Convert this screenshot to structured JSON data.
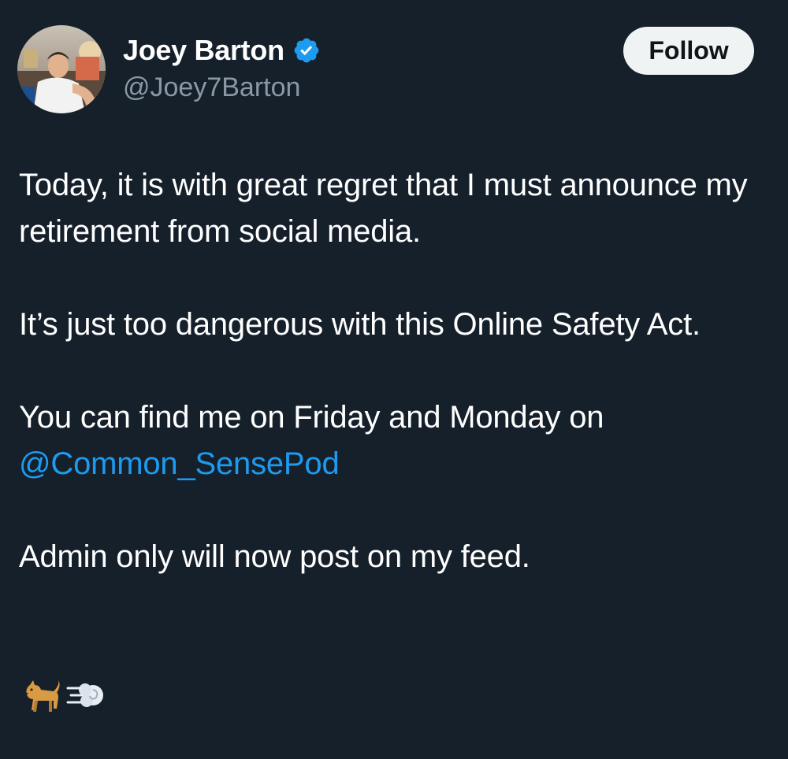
{
  "author": {
    "display_name": "Joey Barton",
    "handle": "@Joey7Barton",
    "verified": true,
    "avatar_icon": "profile-photo"
  },
  "follow_button": {
    "label": "Follow"
  },
  "tweet": {
    "line1": "Today, it is with great regret that I must announce my retirement from social media.",
    "line2": "It’s just too dangerous with this Online Safety Act.",
    "line3_prefix": "You can find me on Friday and Monday on",
    "mention": "@Common_SensePod",
    "line4": "Admin only will now post on my feed.",
    "emojis": [
      "dog-icon",
      "dash-icon"
    ]
  },
  "colors": {
    "background": "#15202b",
    "text": "#ffffff",
    "secondary_text": "#8b98a5",
    "link": "#1d9bf0",
    "verified_badge": "#1d9bf0",
    "follow_button_bg": "#eff3f4"
  }
}
